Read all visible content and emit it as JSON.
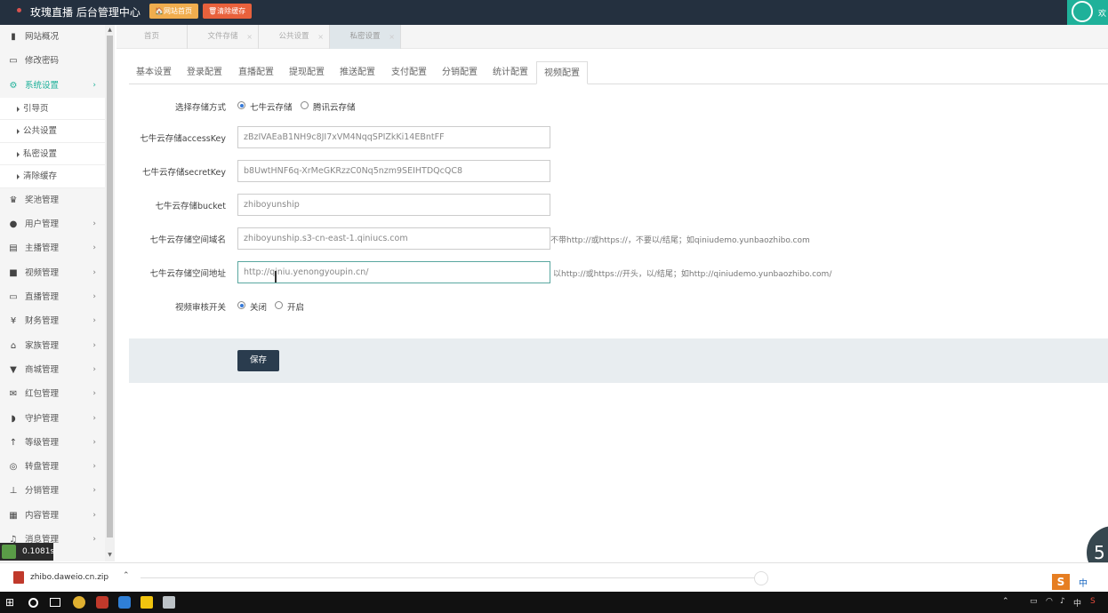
{
  "topbar": {
    "title": "玫瑰直播 后台管理中心",
    "home_button": "🏠网站首页",
    "clear_button": "🗑清除缓存",
    "right_text": "欢"
  },
  "sidebar": {
    "items": [
      {
        "label": "网站概况",
        "icon": "chart-icon"
      },
      {
        "label": "修改密码",
        "icon": "monitor-icon"
      },
      {
        "label": "系统设置",
        "icon": "gear-icon"
      },
      {
        "label": "奖池管理",
        "icon": "trophy-icon"
      },
      {
        "label": "用户管理",
        "icon": "users-icon"
      },
      {
        "label": "主播管理",
        "icon": "id-card-icon"
      },
      {
        "label": "视频管理",
        "icon": "video-icon"
      },
      {
        "label": "直播管理",
        "icon": "monitor-icon"
      },
      {
        "label": "财务管理",
        "icon": "yen-icon"
      },
      {
        "label": "家族管理",
        "icon": "bank-icon"
      },
      {
        "label": "商城管理",
        "icon": "cart-icon"
      },
      {
        "label": "红包管理",
        "icon": "envelope-icon"
      },
      {
        "label": "守护管理",
        "icon": "shield-icon"
      },
      {
        "label": "等级管理",
        "icon": "level-icon"
      },
      {
        "label": "转盘管理",
        "icon": "gamepad-icon"
      },
      {
        "label": "分销管理",
        "icon": "sitemap-icon"
      },
      {
        "label": "内容管理",
        "icon": "grid-icon"
      },
      {
        "label": "消息管理",
        "icon": "bell-icon"
      }
    ],
    "sub_items": [
      "引导页",
      "公共设置",
      "私密设置",
      "清除缓存"
    ]
  },
  "page_tabs": [
    "首页",
    "文件存储",
    "公共设置",
    "私密设置"
  ],
  "sub_tabs": [
    "基本设置",
    "登录配置",
    "直播配置",
    "提现配置",
    "推送配置",
    "支付配置",
    "分销配置",
    "统计配置",
    "视频配置"
  ],
  "form": {
    "storage_label": "选择存储方式",
    "storage_options": [
      "七牛云存储",
      "腾讯云存储"
    ],
    "storage_selected": "七牛云存储",
    "access_key_label": "七牛云存储accessKey",
    "access_key_value": "zBzIVAEaB1NH9c8JI7xVM4NqqSPIZkKi14EBntFF",
    "secret_key_label": "七牛云存储secretKey",
    "secret_key_value": "b8UwtHNF6q-XrMeGKRzzC0Nq5nzm9SEIHTDQcQC8",
    "bucket_label": "七牛云存储bucket",
    "bucket_value": "zhiboyunship",
    "domain_label": "七牛云存储空间域名",
    "domain_value": "zhiboyunship.s3-cn-east-1.qiniucs.com",
    "domain_hint": "不带http://或https://，不要以/结尾；如qiniudemo.yunbaozhibo.com",
    "address_label": "七牛云存储空间地址",
    "address_value": "http://qiniu.yenongyoupin.cn/",
    "address_hint": "以http://或https://开头，以/结尾；如http://qiniudemo.yunbaozhibo.com/",
    "audit_label": "视频审核开关",
    "audit_options": [
      "关闭",
      "开启"
    ],
    "audit_selected": "关闭",
    "save_label": "保存"
  },
  "overlay": {
    "timer": "0.1081s",
    "bubble_text": "5"
  },
  "download": {
    "filename": "zhibo.daweio.cn.zip"
  },
  "tray": {
    "ime": "中"
  },
  "colors": {
    "topbar": "#24303f",
    "accent": "#1fb19a",
    "home_button": "#f0ad4e",
    "clear_button": "#e8613c",
    "save_button": "#2a3c4e"
  }
}
